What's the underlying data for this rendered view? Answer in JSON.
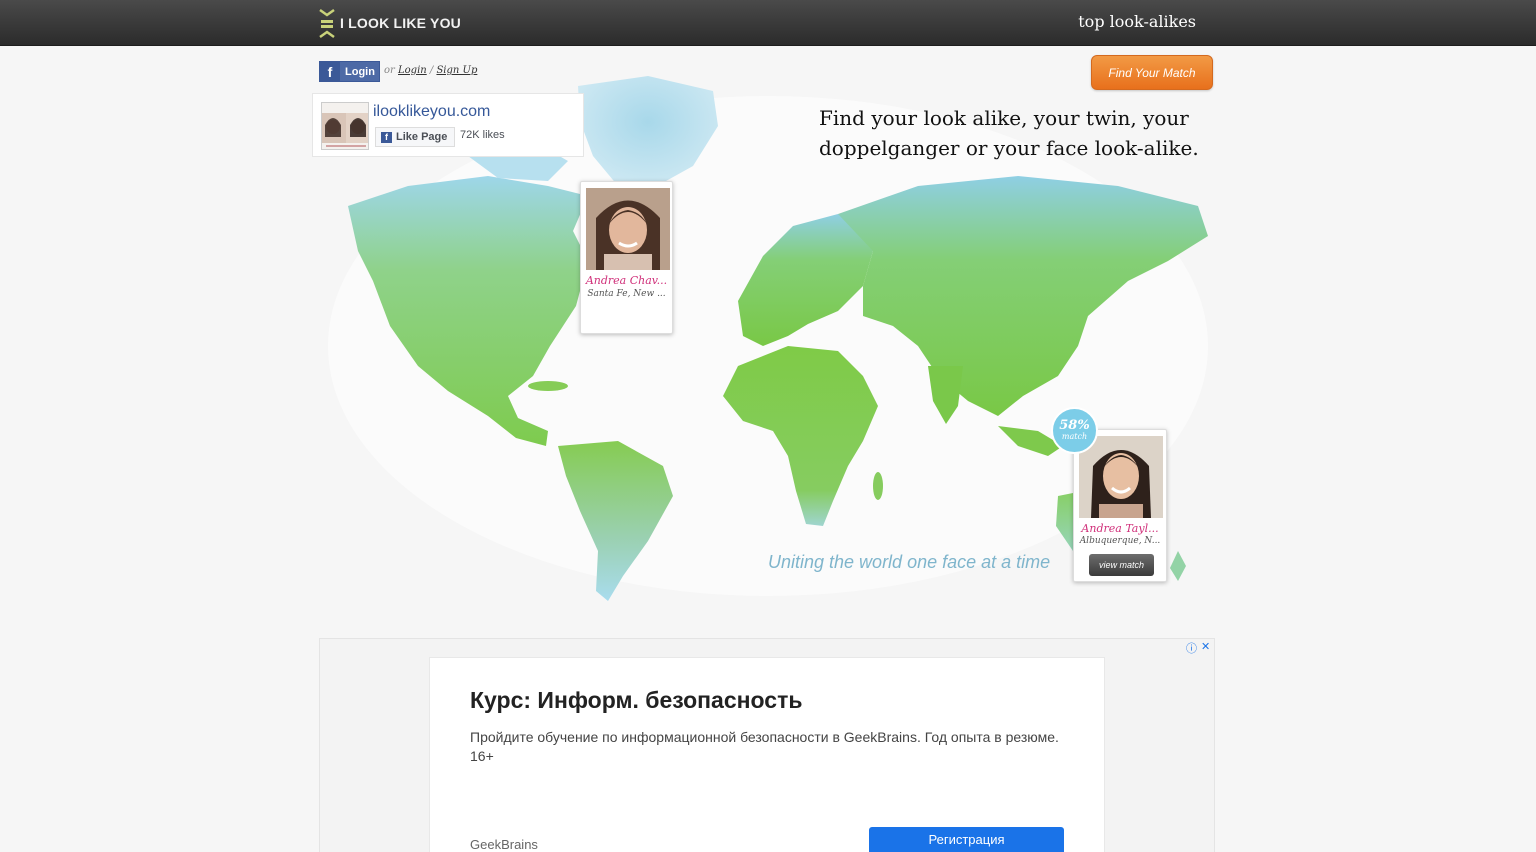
{
  "header": {
    "logo_text": "I LOOK LIKE YOU",
    "top_link": "top look-alikes"
  },
  "auth": {
    "facebook_login": "Login",
    "or": "or",
    "login": "Login",
    "separator": "/",
    "signup": "Sign Up"
  },
  "facebook_widget": {
    "page_name": "ilooklikeyou.com",
    "like_button": "Like Page",
    "likes": "72K likes"
  },
  "hero": {
    "cta": "Find Your Match",
    "tagline_line1": "Find your look alike, your twin, your",
    "tagline_line2": "doppelganger or your face look-alike.",
    "subtitle": "Uniting the world one face at a time"
  },
  "cards": [
    {
      "name": "Andrea Chav...",
      "location": "Santa Fe, New ..."
    },
    {
      "name": "Andrea Tayl...",
      "location": "Albuquerque, N...",
      "button": "view match"
    }
  ],
  "match_badge": {
    "percent": "58%",
    "label": "match"
  },
  "ad": {
    "title": "Курс: Информ. безопасность",
    "description": "Пройдите обучение по информационной безопасности в GeekBrains. Год опыта в резюме. 16+",
    "brand": "GeekBrains",
    "cta": "Регистрация",
    "info_icon": "ⓘ",
    "close_icon": "✕"
  },
  "colors": {
    "accent_orange": "#e8701c",
    "name_pink": "#d0307a",
    "facebook_blue": "#3b5998",
    "ad_button": "#1a73e8",
    "map_green": "#7fcf4f",
    "map_blue": "#8fcbe6"
  }
}
